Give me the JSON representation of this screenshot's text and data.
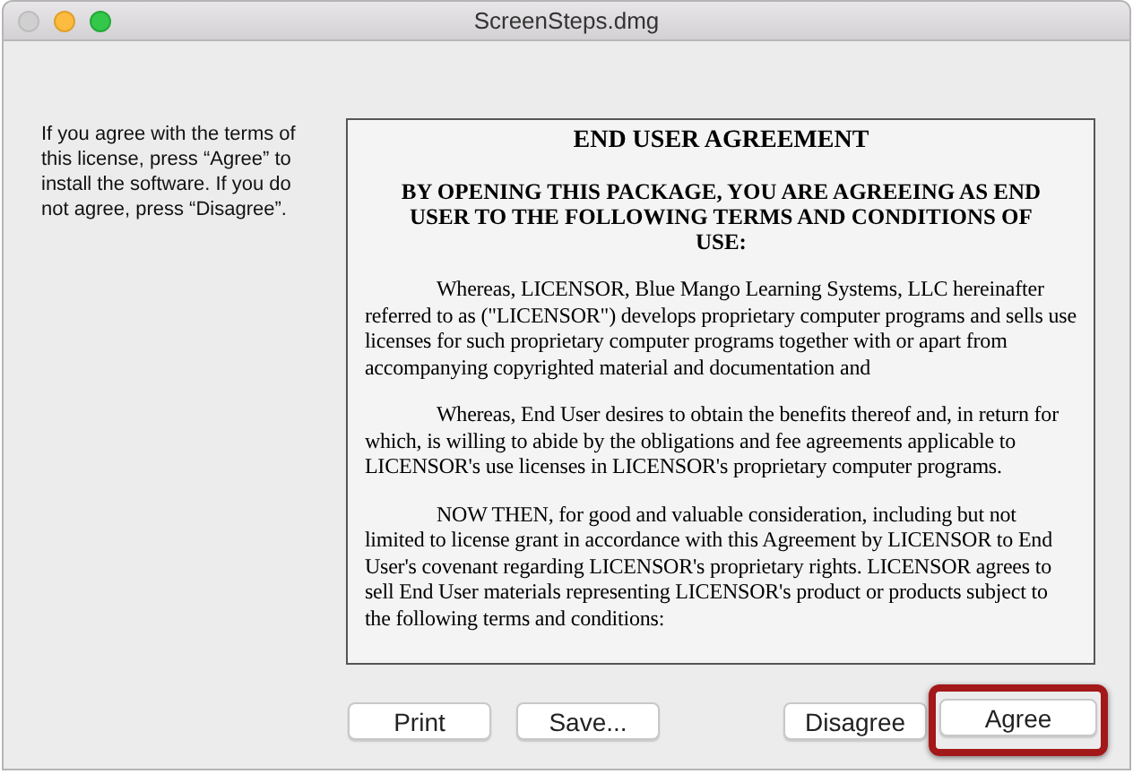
{
  "window": {
    "title": "ScreenSteps.dmg"
  },
  "instructions": "If you agree with the terms of this license, press “Agree” to install the software. If you do not agree, press “Disagree”.",
  "document": {
    "title": "END USER AGREEMENT",
    "heading": "BY OPENING THIS PACKAGE, YOU ARE AGREEING AS END USER TO THE FOLLOWING TERMS AND CONDITIONS OF USE:",
    "paragraphs": [
      "Whereas, LICENSOR, Blue Mango Learning Systems, LLC hereinafter referred to as (\"LICENSOR\") develops proprietary computer programs and sells use licenses for such proprietary computer programs together with or apart from accompanying copyrighted material and documentation and",
      "Whereas, End User desires to obtain the benefits thereof and, in return for which, is willing to abide by the obligations and fee agreements applicable to LICENSOR's use licenses in LICENSOR's proprietary computer programs.",
      "NOW THEN, for good and valuable consideration, including but not limited to license grant in accordance with this Agreement by LICENSOR to End User's covenant regarding LICENSOR's proprietary rights.  LICENSOR agrees to sell End User materials representing LICENSOR's product or products subject to the following terms and conditions:"
    ]
  },
  "buttons": [
    {
      "label": "Print",
      "highlighted": false
    },
    {
      "label": "Save...",
      "highlighted": false
    },
    {
      "label": "Disagree",
      "highlighted": false
    },
    {
      "label": "Agree",
      "highlighted": true
    }
  ]
}
